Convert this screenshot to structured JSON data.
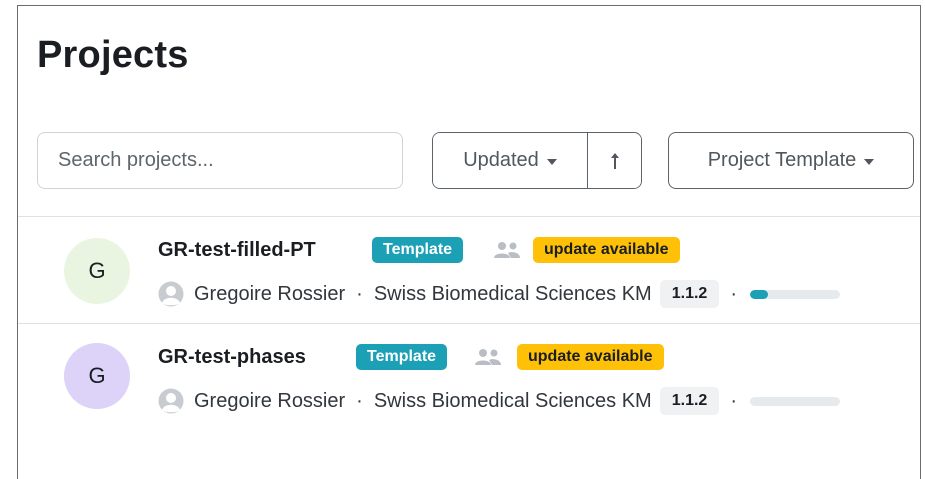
{
  "page": {
    "title": "Projects"
  },
  "toolbar": {
    "search_placeholder": "Search projects...",
    "sort_label": "Updated",
    "sort_direction_icon": "arrow-up-icon",
    "filter_label": "Project Template"
  },
  "colors": {
    "template_badge": "#1ba0b5",
    "update_badge": "#ffc107",
    "progress_fill": "#1ba0b5"
  },
  "projects": [
    {
      "avatar_letter": "G",
      "avatar_color": "#e9f5e1",
      "name": "GR-test-filled-PT",
      "template_badge": "Template",
      "update_badge": "update available",
      "owner": "Gregoire Rossier",
      "knowledge_model": "Swiss Biomedical Sciences KM",
      "version": "1.1.2",
      "progress": 0.2
    },
    {
      "avatar_letter": "G",
      "avatar_color": "#ddd2f8",
      "name": "GR-test-phases",
      "template_badge": "Template",
      "update_badge": "update available",
      "owner": "Gregoire Rossier",
      "knowledge_model": "Swiss Biomedical Sciences KM",
      "version": "1.1.2",
      "progress": 0
    }
  ],
  "separator": "·"
}
